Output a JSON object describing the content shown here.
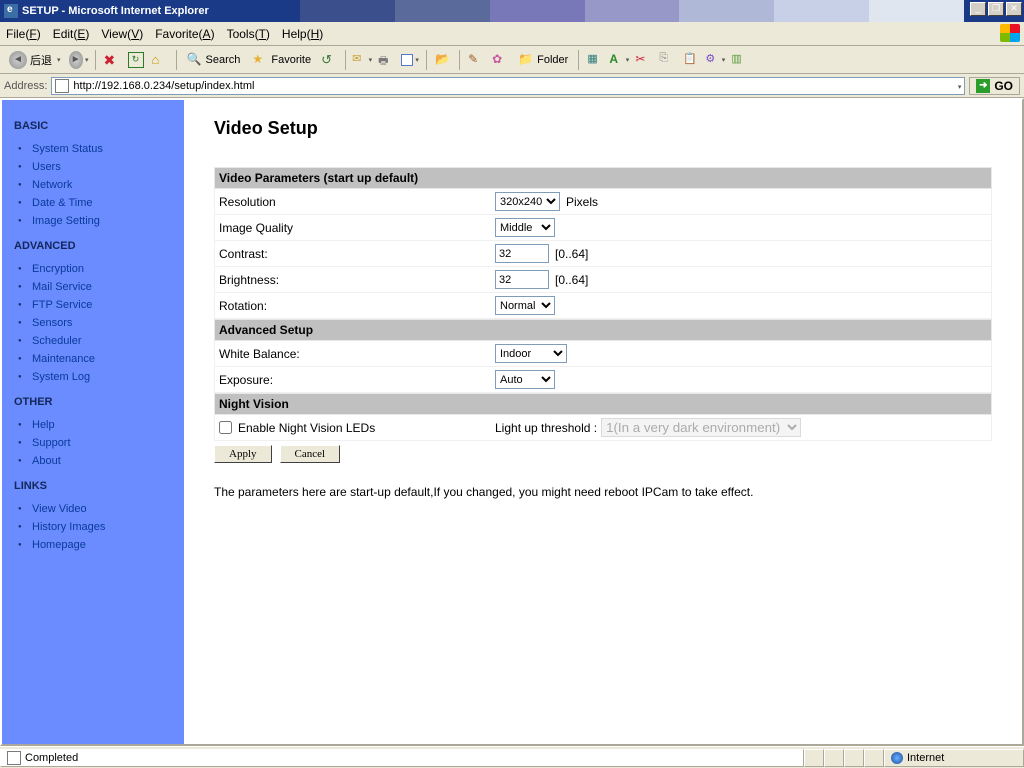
{
  "window": {
    "title": "SETUP - Microsoft Internet Explorer"
  },
  "menu": {
    "file": "File(F)",
    "edit": "Edit(E)",
    "view": "View(V)",
    "favorite": "Favorite(A)",
    "tools": "Tools(T)",
    "help": "Help(H)"
  },
  "toolbar": {
    "back": "后退",
    "search": "Search",
    "favorite": "Favorite",
    "folder": "Folder"
  },
  "address": {
    "label": "Address:",
    "url": "http://192.168.0.234/setup/index.html",
    "go": "GO"
  },
  "sidebar": {
    "basic_hdr": "BASIC",
    "basic": [
      "System Status",
      "Users",
      "Network",
      "Date & Time",
      "Image Setting"
    ],
    "adv_hdr": "ADVANCED",
    "advanced": [
      "Encryption",
      "Mail Service",
      "FTP Service",
      "Sensors",
      "Scheduler",
      "Maintenance",
      "System Log"
    ],
    "other_hdr": "OTHER",
    "other": [
      "Help",
      "Support",
      "About"
    ],
    "links_hdr": "LINKS",
    "links": [
      "View Video",
      "History Images",
      "Homepage"
    ]
  },
  "main": {
    "title": "Video Setup",
    "sec_video": "Video Parameters (start up default)",
    "resolution_lbl": "Resolution",
    "resolution_val": "320x240",
    "resolution_unit": "Pixels",
    "quality_lbl": "Image Quality",
    "quality_val": "Middle",
    "contrast_lbl": "Contrast:",
    "contrast_val": "32",
    "contrast_range": "[0..64]",
    "bright_lbl": "Brightness:",
    "bright_val": "32",
    "bright_range": "[0..64]",
    "rotation_lbl": "Rotation:",
    "rotation_val": "Normal",
    "sec_adv": "Advanced Setup",
    "wb_lbl": "White Balance:",
    "wb_val": "Indoor",
    "exp_lbl": "Exposure:",
    "exp_val": "Auto",
    "sec_nv": "Night Vision",
    "nv_enable_lbl": "Enable Night Vision LEDs",
    "nv_thresh_lbl": "Light up threshold :",
    "nv_thresh_val": "1(In a very dark environment)",
    "apply": "Apply",
    "cancel": "Cancel",
    "note": "The parameters here are start-up default,If you changed, you might need reboot IPCam to take effect."
  },
  "status": {
    "completed": "Completed",
    "zone": "Internet"
  }
}
